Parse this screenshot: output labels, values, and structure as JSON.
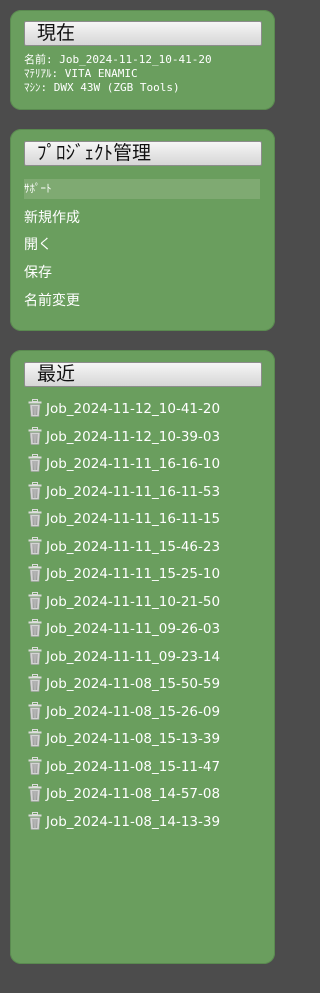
{
  "current": {
    "title": "現在",
    "name_line": "名前: Job_2024-11-12_10-41-20",
    "material_line": "ﾏﾃﾘｱﾙ: VITA ENAMIC",
    "machine_line": "ﾏｼﾝ: DWX 43W (ZGB Tools)"
  },
  "project": {
    "title": "ﾌﾟﾛｼﾞｪｸﾄ管理",
    "items": [
      {
        "label": "ｻﾎﾟｰﾄ"
      },
      {
        "label": "新規作成"
      },
      {
        "label": "開く"
      },
      {
        "label": "保存"
      },
      {
        "label": "名前変更"
      }
    ]
  },
  "recent": {
    "title": "最近",
    "items": [
      {
        "label": "Job_2024-11-12_10-41-20"
      },
      {
        "label": "Job_2024-11-12_10-39-03"
      },
      {
        "label": "Job_2024-11-11_16-16-10"
      },
      {
        "label": "Job_2024-11-11_16-11-53"
      },
      {
        "label": "Job_2024-11-11_16-11-15"
      },
      {
        "label": "Job_2024-11-11_15-46-23"
      },
      {
        "label": "Job_2024-11-11_15-25-10"
      },
      {
        "label": "Job_2024-11-11_10-21-50"
      },
      {
        "label": "Job_2024-11-11_09-26-03"
      },
      {
        "label": "Job_2024-11-11_09-23-14"
      },
      {
        "label": "Job_2024-11-08_15-50-59"
      },
      {
        "label": "Job_2024-11-08_15-26-09"
      },
      {
        "label": "Job_2024-11-08_15-13-39"
      },
      {
        "label": "Job_2024-11-08_15-11-47"
      },
      {
        "label": "Job_2024-11-08_14-57-08"
      },
      {
        "label": "Job_2024-11-08_14-13-39"
      }
    ]
  },
  "icons": {
    "recent_item_icon": "trash-icon"
  },
  "colors": {
    "panel": "#6a9e5e",
    "background": "#4c4c4c",
    "selected_row": "#7faa72",
    "icon": "#dcdcdc"
  }
}
